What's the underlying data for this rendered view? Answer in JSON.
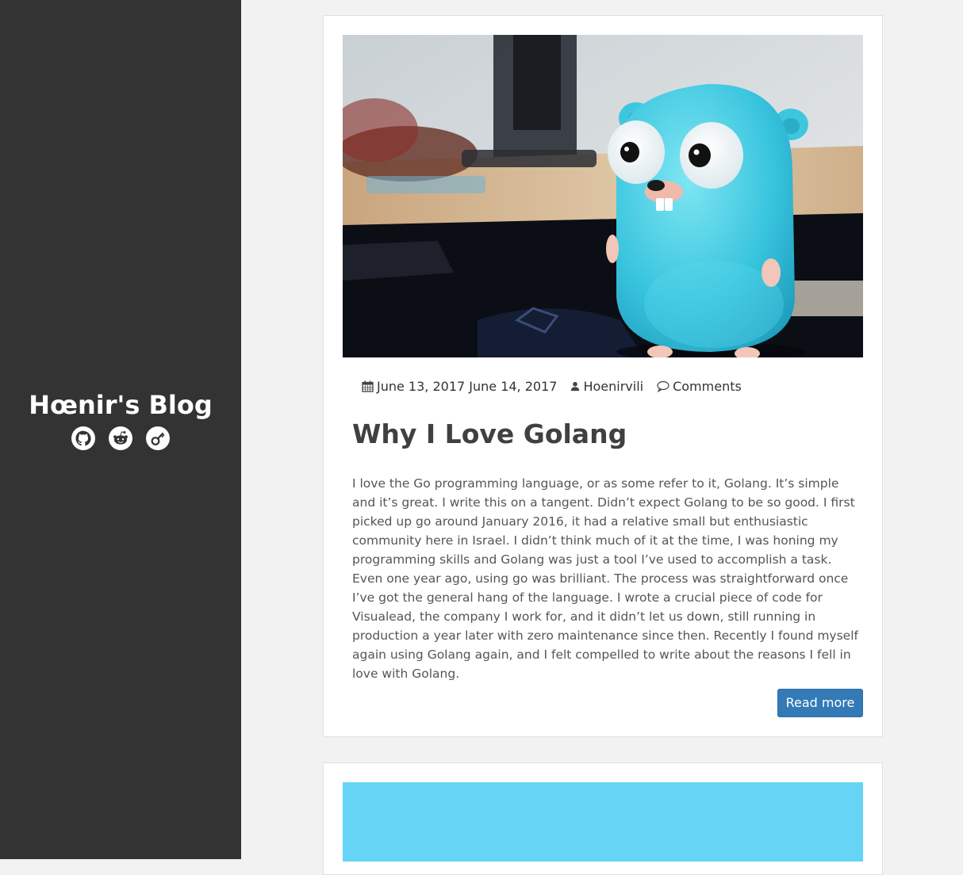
{
  "site": {
    "title": "Hœnir's Blog",
    "social_links": [
      {
        "icon": "github-icon"
      },
      {
        "icon": "reddit-icon"
      },
      {
        "icon": "keybase-icon"
      }
    ]
  },
  "posts": [
    {
      "image": "go-gopher-photo",
      "meta": {
        "date": "June 13, 2017 June 14, 2017",
        "author": "Hoenirvili",
        "comments": "Comments"
      },
      "title": "Why I Love Golang",
      "excerpt": "I love the Go programming language, or as some refer to it, Golang. It’s simple and it’s great. I write this on a tangent. Didn’t expect Golang to be so good. I first picked up go around January 2016, it had a relative small but enthusiastic community here in Israel. I didn’t think much of it at the time, I was honing my programming skills and Golang was just a tool I’ve used to accomplish a task. Even one year ago, using go was brilliant. The process was straightforward once I’ve got the general hang of the language. I wrote a crucial piece of code for Visualead, the company I work for, and it didn’t let us down, still running in production a year later with zero maintenance since then. Recently I found myself again using Golang again, and I felt compelled to write about the reasons I fell in love with Golang.",
      "read_more": "Read more"
    }
  ],
  "colors": {
    "sidebar": "#333333",
    "background": "#f2f2f2",
    "button": "#337ab7",
    "gopher": "#5fd8e8",
    "next_post_banner": "#66d5f5"
  }
}
